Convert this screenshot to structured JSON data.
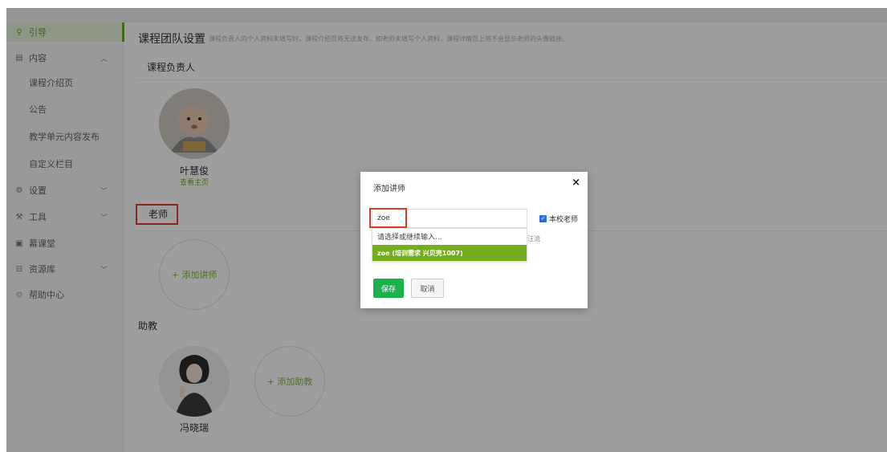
{
  "sidebar": {
    "items": [
      {
        "label": "引导",
        "icon": "pin-icon"
      },
      {
        "label": "内容",
        "icon": "document-icon"
      },
      {
        "label": "课程介绍页"
      },
      {
        "label": "公告"
      },
      {
        "label": "教学单元内容发布"
      },
      {
        "label": "自定义栏目"
      },
      {
        "label": "设置",
        "icon": "gear-icon"
      },
      {
        "label": "工具",
        "icon": "wrench-icon"
      },
      {
        "label": "幕课堂",
        "icon": "classroom-icon"
      },
      {
        "label": "资源库",
        "icon": "library-icon"
      },
      {
        "label": "帮助中心",
        "icon": "help-icon"
      }
    ]
  },
  "main": {
    "title": "课程团队设置",
    "note": "课程负责人的个人资料未填写时，课程介绍页将无法发布，如老师未填写个人资料，课程详情页上将不会显示老师的头像链接。",
    "owner_heading": "课程负责人",
    "owner_name": "叶慧俊",
    "owner_link": "查看主页",
    "teacher_heading": "老师",
    "add_teacher": "+ 添加讲师",
    "assistant_heading": "助教",
    "add_assistant": "+ 添加助教",
    "assistant_name": "冯晓瑞"
  },
  "modal": {
    "title": "添加讲师",
    "close": "×",
    "input_value": "zoe",
    "dropdown_hint": "请选择或继续输入...",
    "dropdown_option": "zoe (培训需求 兴贝壳1007)",
    "checkbox_label": "本校老师",
    "checkbox_checked": true,
    "hidden_fragment": "汪流",
    "save": "保存",
    "cancel": "取消"
  },
  "colors": {
    "accent_green": "#6ab023",
    "save_green": "#1bb24a",
    "option_green": "#77ac1e",
    "highlight_red": "#e1402a",
    "checkbox_blue": "#2b6fd6"
  }
}
